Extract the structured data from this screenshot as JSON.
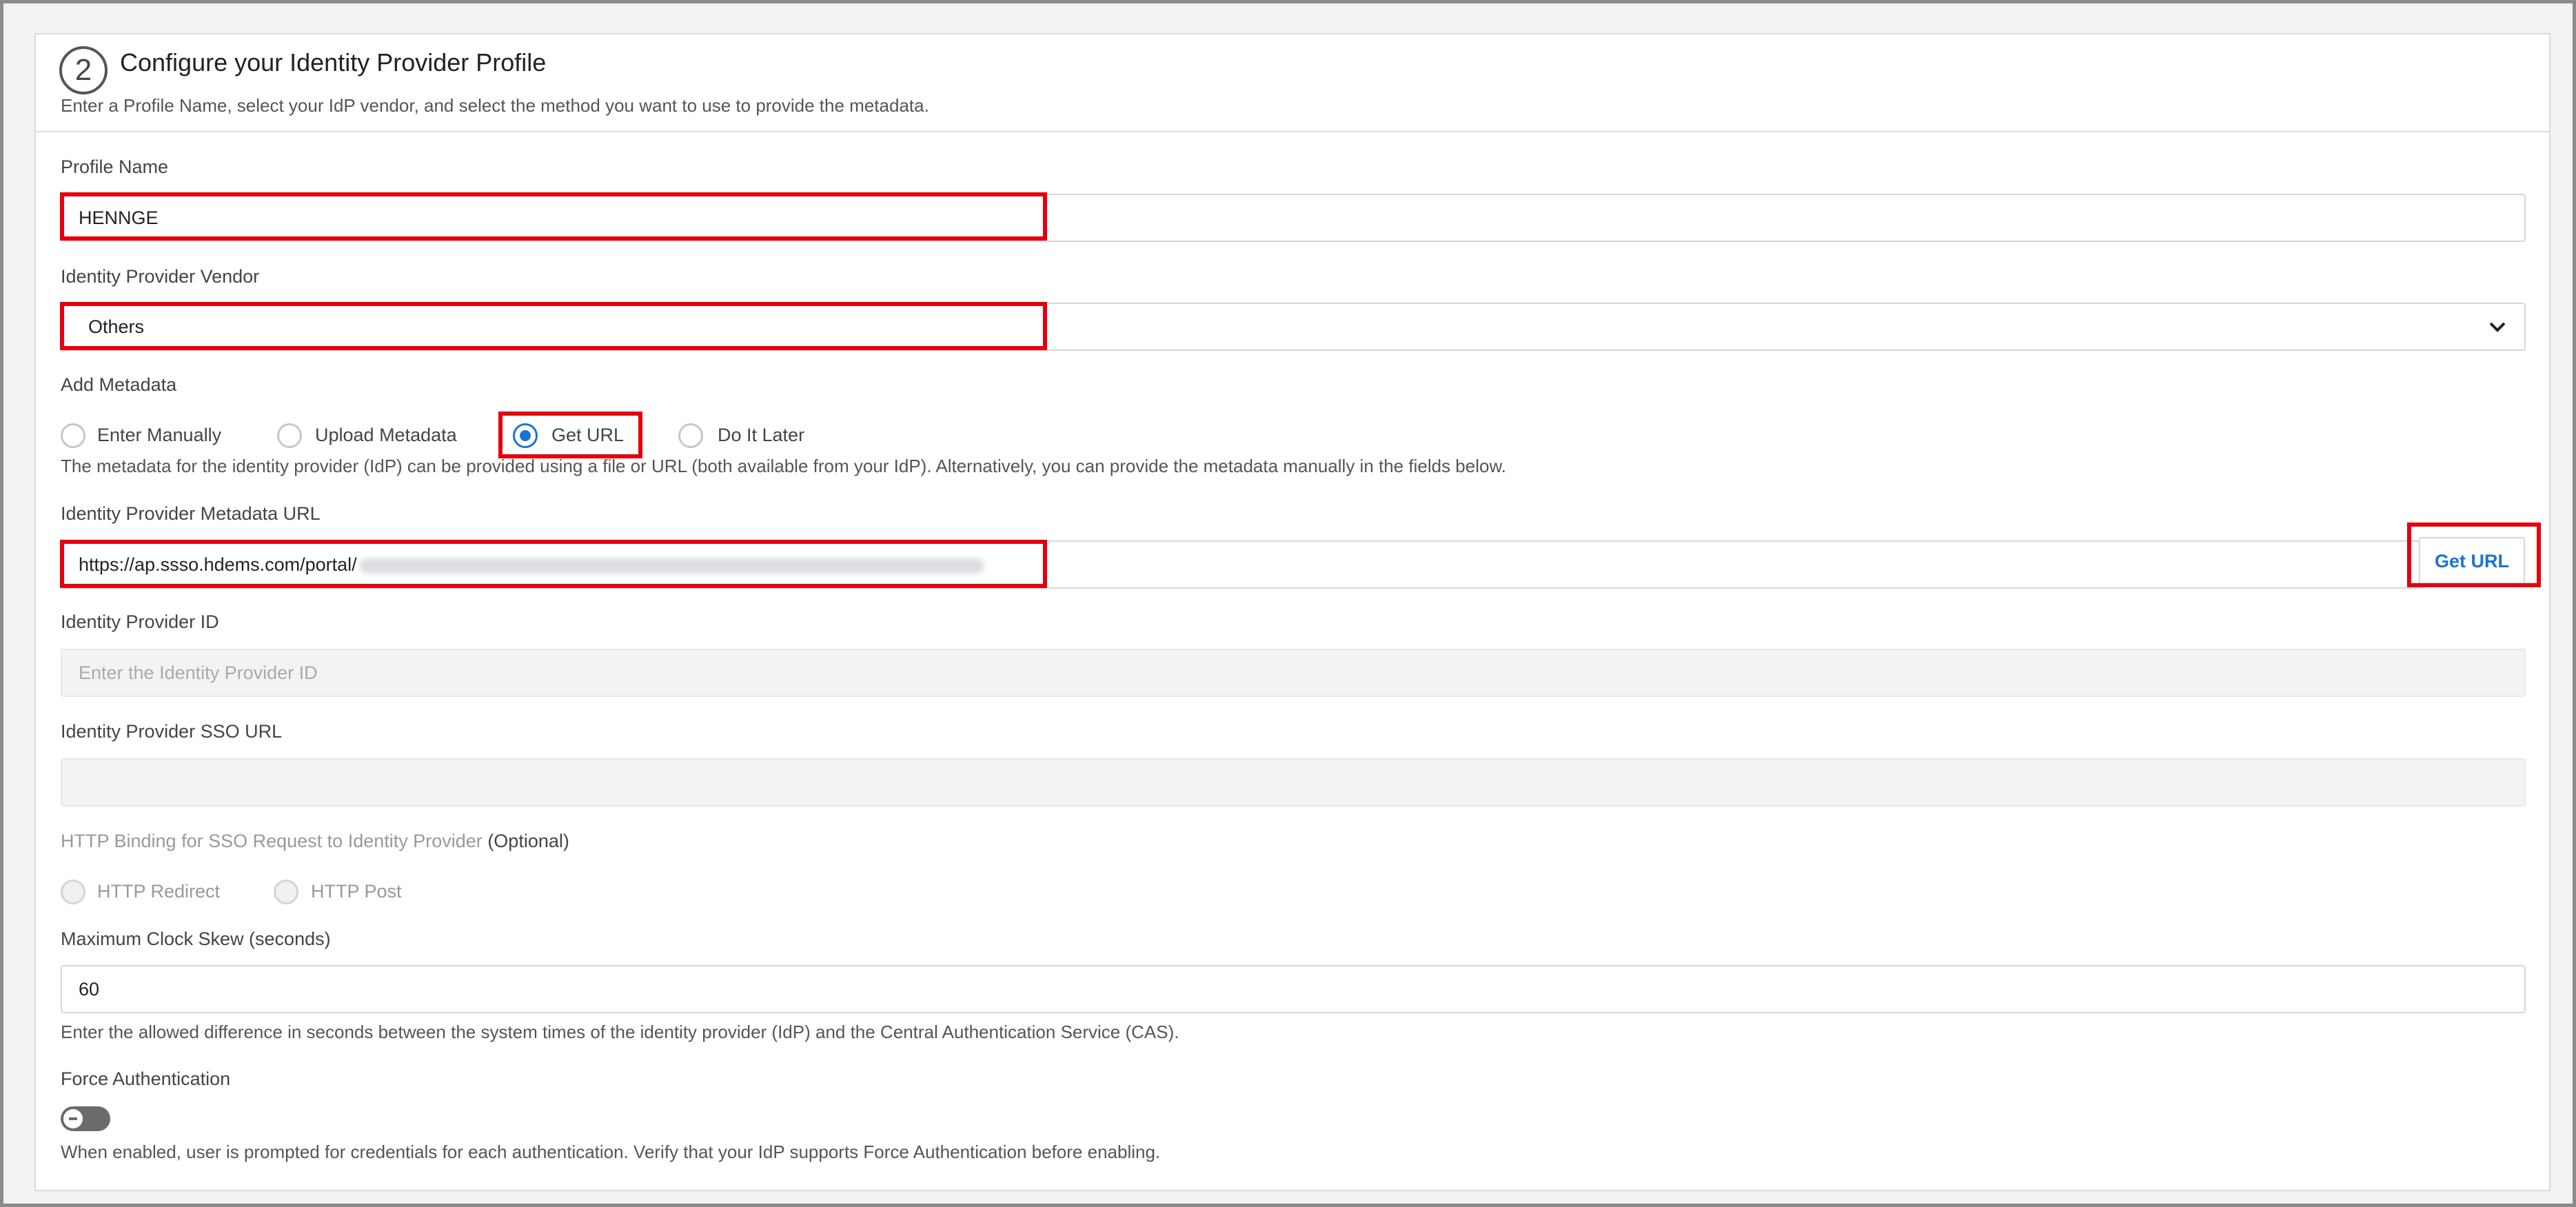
{
  "header": {
    "step_number": "2",
    "title": "Configure your Identity Provider Profile",
    "subtitle": "Enter a Profile Name, select your IdP vendor, and select the method you want to use to provide the metadata."
  },
  "profile_name": {
    "label": "Profile Name",
    "value": "HENNGE"
  },
  "vendor": {
    "label": "Identity Provider Vendor",
    "selected": "Others"
  },
  "add_metadata": {
    "label": "Add Metadata",
    "options": [
      "Enter Manually",
      "Upload Metadata",
      "Get URL",
      "Do It Later"
    ],
    "selected": "Get URL",
    "help": "The metadata for the identity provider (IdP) can be provided using a file or URL (both available from your IdP). Alternatively, you can provide the metadata manually in the fields below."
  },
  "metadata_url": {
    "label": "Identity Provider Metadata URL",
    "value": "https://ap.ssso.hdems.com/portal/",
    "button": "Get URL"
  },
  "idp_id": {
    "label": "Identity Provider ID",
    "placeholder": "Enter the Identity Provider ID"
  },
  "sso_url": {
    "label": "Identity Provider SSO URL",
    "value": ""
  },
  "http_binding": {
    "label": "HTTP Binding for SSO Request to Identity Provider",
    "optional": "(Optional)",
    "options": [
      "HTTP Redirect",
      "HTTP Post"
    ]
  },
  "clock_skew": {
    "label": "Maximum Clock Skew (seconds)",
    "value": "60",
    "help": "Enter the allowed difference in seconds between the system times of the identity provider (IdP) and the Central Authentication Service (CAS)."
  },
  "force_auth": {
    "label": "Force Authentication",
    "enabled": false,
    "help": "When enabled, user is prompted for credentials for each authentication. Verify that your IdP supports Force Authentication before enabling."
  },
  "colors": {
    "accent": "#1a74d3",
    "highlight": "#e4000f",
    "toggle_off": "#6b6b6b"
  }
}
